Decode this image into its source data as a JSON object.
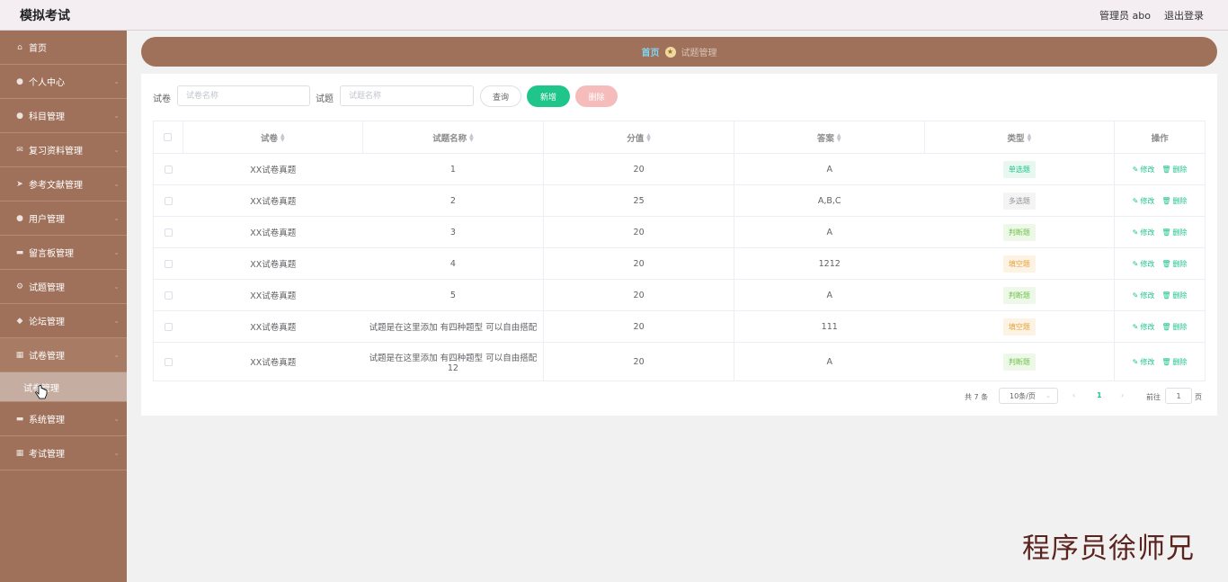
{
  "app": {
    "title": "模拟考试",
    "admin_label": "管理员 abo",
    "logout_label": "退出登录"
  },
  "sidebar": {
    "items": [
      {
        "label": "首页",
        "icon": "home-icon",
        "glyph": "⌂",
        "arrow": false
      },
      {
        "label": "个人中心",
        "icon": "user-icon",
        "glyph": "●",
        "arrow": true
      },
      {
        "label": "科目管理",
        "icon": "user-icon",
        "glyph": "●",
        "arrow": true
      },
      {
        "label": "复习资料管理",
        "icon": "mail-icon",
        "glyph": "✉",
        "arrow": true
      },
      {
        "label": "参考文献管理",
        "icon": "send-icon",
        "glyph": "➤",
        "arrow": true
      },
      {
        "label": "用户管理",
        "icon": "user-icon",
        "glyph": "●",
        "arrow": true
      },
      {
        "label": "留言板管理",
        "icon": "folder-icon",
        "glyph": "▬",
        "arrow": true
      },
      {
        "label": "试题管理",
        "icon": "settings-icon",
        "glyph": "⚙",
        "arrow": true
      },
      {
        "label": "论坛管理",
        "icon": "goods-icon",
        "glyph": "◆",
        "arrow": true
      },
      {
        "label": "试卷管理",
        "icon": "grid-icon",
        "glyph": "▦",
        "arrow": true,
        "open": true
      },
      {
        "label": "系统管理",
        "icon": "suitcase-icon",
        "glyph": "▬",
        "arrow": true
      },
      {
        "label": "考试管理",
        "icon": "menu-icon",
        "glyph": "▦",
        "arrow": true
      }
    ],
    "sub_item": "试卷管理"
  },
  "breadcrumb": {
    "home": "首页",
    "current": "试题管理"
  },
  "search": {
    "paper_label": "试卷",
    "paper_placeholder": "试卷名称",
    "question_label": "试题",
    "question_placeholder": "试题名称",
    "query_label": "查询",
    "add_label": "新增",
    "delete_label": "删除"
  },
  "table": {
    "headers": {
      "paper": "试卷",
      "name": "试题名称",
      "score": "分值",
      "answer": "答案",
      "type": "类型",
      "ops": "操作"
    },
    "edit_label": "修改",
    "delete_label": "删除",
    "rows": [
      {
        "paper": "XX试卷真题",
        "name": "1",
        "score": "20",
        "answer": "A",
        "type": "单选题",
        "type_color": "#1fc58a",
        "type_bg": "#e8f8f1",
        "tall": false
      },
      {
        "paper": "XX试卷真题",
        "name": "2",
        "score": "25",
        "answer": "A,B,C",
        "type": "多选题",
        "type_color": "#909399",
        "type_bg": "#f4f4f5",
        "tall": false
      },
      {
        "paper": "XX试卷真题",
        "name": "3",
        "score": "20",
        "answer": "A",
        "type": "判断题",
        "type_color": "#6cc24a",
        "type_bg": "#eef8e8",
        "tall": false
      },
      {
        "paper": "XX试卷真题",
        "name": "4",
        "score": "20",
        "answer": "1212",
        "type": "填空题",
        "type_color": "#e6a23c",
        "type_bg": "#fdf3e4",
        "tall": false
      },
      {
        "paper": "XX试卷真题",
        "name": "5",
        "score": "20",
        "answer": "A",
        "type": "判断题",
        "type_color": "#6cc24a",
        "type_bg": "#eef8e8",
        "tall": false
      },
      {
        "paper": "XX试卷真题",
        "name": "试题是在这里添加 有四种题型 可以自由搭配",
        "score": "20",
        "answer": "111",
        "type": "填空题",
        "type_color": "#e6a23c",
        "type_bg": "#fdf3e4",
        "tall": false
      },
      {
        "paper": "XX试卷真题",
        "name": "试题是在这里添加 有四种题型 可以自由搭配12",
        "score": "20",
        "answer": "A",
        "type": "判断题",
        "type_color": "#6cc24a",
        "type_bg": "#eef8e8",
        "tall": true
      }
    ]
  },
  "pagination": {
    "total": "共 7 条",
    "page_size": "10条/页",
    "current_page": "1",
    "goto_label": "前往",
    "goto_value": "1",
    "page_unit": "页"
  },
  "watermark": "程序员徐师兄",
  "colors": {
    "brand": "#a0715a",
    "accent": "#1fc58a",
    "danger_light": "#f6bcbc"
  }
}
